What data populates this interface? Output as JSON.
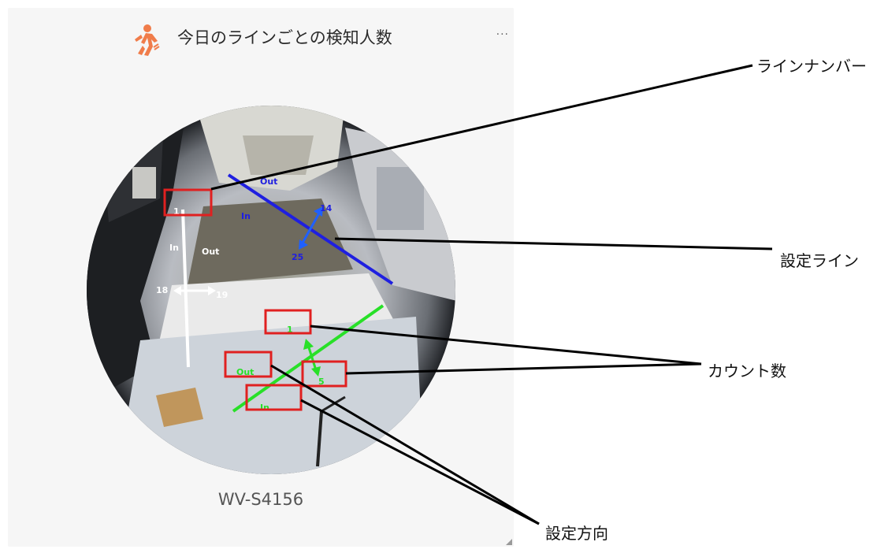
{
  "widget": {
    "title": "今日のラインごとの検知人数",
    "more_label": "...",
    "camera_name": "WV-S4156",
    "icon": "walking-person-icon",
    "icon_color": "#f07c4a"
  },
  "overlay": {
    "line1": {
      "number": "1",
      "in_label": "In",
      "out_label": "Out",
      "count_left": "18",
      "count_right": "19",
      "color": "#ffffff"
    },
    "line2": {
      "out_label": "Out",
      "in_label": "In",
      "count_a": "14",
      "count_b": "25",
      "color": "#1f1fe0"
    },
    "line3": {
      "count_top": "1",
      "count_right": "5",
      "out_label": "Out",
      "in_label": "In",
      "color": "#28e028"
    }
  },
  "callouts": {
    "line_number": "ラインナンバー",
    "setting_line": "設定ライン",
    "count": "カウント数",
    "setting_direction": "設定方向"
  }
}
